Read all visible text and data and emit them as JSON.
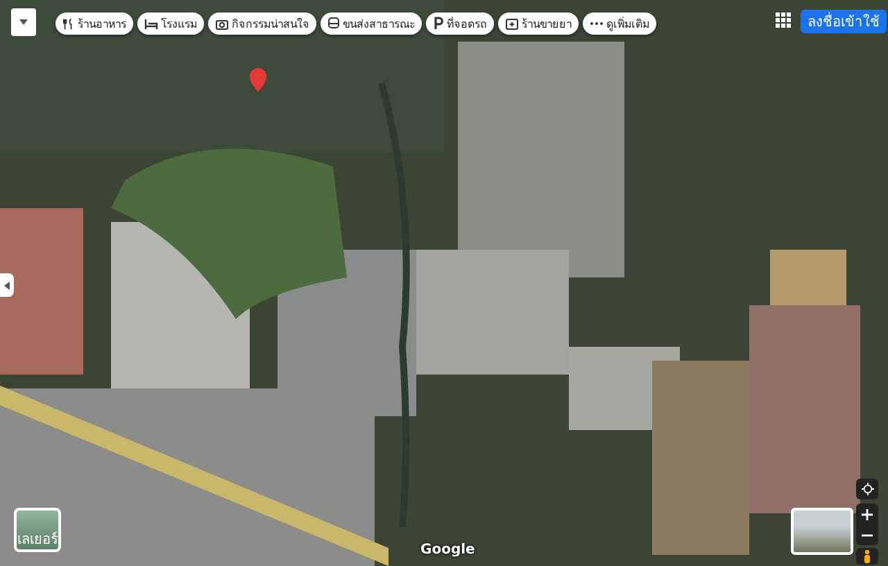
{
  "chips": [
    {
      "kind": "restaurant",
      "label": "ร้านอาหาร"
    },
    {
      "kind": "hotel",
      "label": "โรงแรม"
    },
    {
      "kind": "camera",
      "label": "กิจกรรมน่าสนใจ"
    },
    {
      "kind": "transit",
      "label": "ขนส่งสาธารณะ"
    },
    {
      "kind": "parking",
      "label": "ที่จอดรถ"
    },
    {
      "kind": "pharmacy",
      "label": "ร้านขายยา"
    },
    {
      "kind": "more",
      "label": "ดูเพิ่มเติม"
    }
  ],
  "sign_in": {
    "label": "ลงชื่อเข้าใช้"
  },
  "layers": {
    "label": "เลเยอร์"
  },
  "logo": {
    "label": "Google"
  }
}
